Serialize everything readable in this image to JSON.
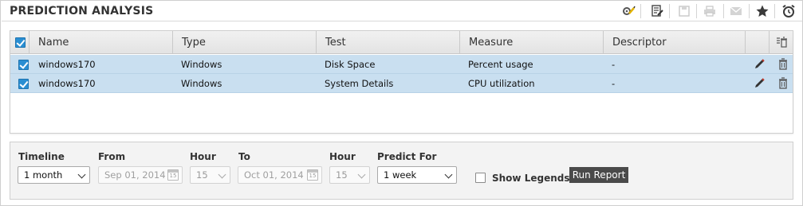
{
  "header": {
    "title": "PREDICTION ANALYSIS",
    "toolbar": [
      {
        "icon": "configure-icon",
        "enabled": true
      },
      {
        "icon": "edit-report-icon",
        "enabled": true
      },
      {
        "icon": "save-icon",
        "enabled": false
      },
      {
        "icon": "print-icon",
        "enabled": false
      },
      {
        "icon": "email-icon",
        "enabled": false
      },
      {
        "icon": "favorite-star-icon",
        "enabled": true
      },
      {
        "icon": "alarm-clock-icon",
        "enabled": true
      }
    ]
  },
  "table": {
    "columns": [
      "Name",
      "Type",
      "Test",
      "Measure",
      "Descriptor"
    ],
    "rows": [
      {
        "checked": true,
        "name": "windows170",
        "type": "Windows",
        "test": "Disk Space",
        "measure": "Percent usage",
        "descriptor": "-"
      },
      {
        "checked": true,
        "name": "windows170",
        "type": "Windows",
        "test": "System Details",
        "measure": "CPU utilization",
        "descriptor": "-"
      }
    ],
    "colors": {
      "row_selected": "#c9dff0",
      "checkbox": "#2a8ed2"
    }
  },
  "filters": {
    "timeline_label": "Timeline",
    "timeline_value": "1 month",
    "from_label": "From",
    "from_value": "Sep 01, 2014",
    "from_hour_label": "Hour",
    "from_hour_value": "15",
    "to_label": "To",
    "to_value": "Oct 01, 2014",
    "to_hour_label": "Hour",
    "to_hour_value": "15",
    "predict_label": "Predict For",
    "predict_value": "1 week",
    "calendar_glyph": "15",
    "show_legends_label": "Show Legends",
    "show_legends_checked": false,
    "run_report_label": "Run Report"
  }
}
